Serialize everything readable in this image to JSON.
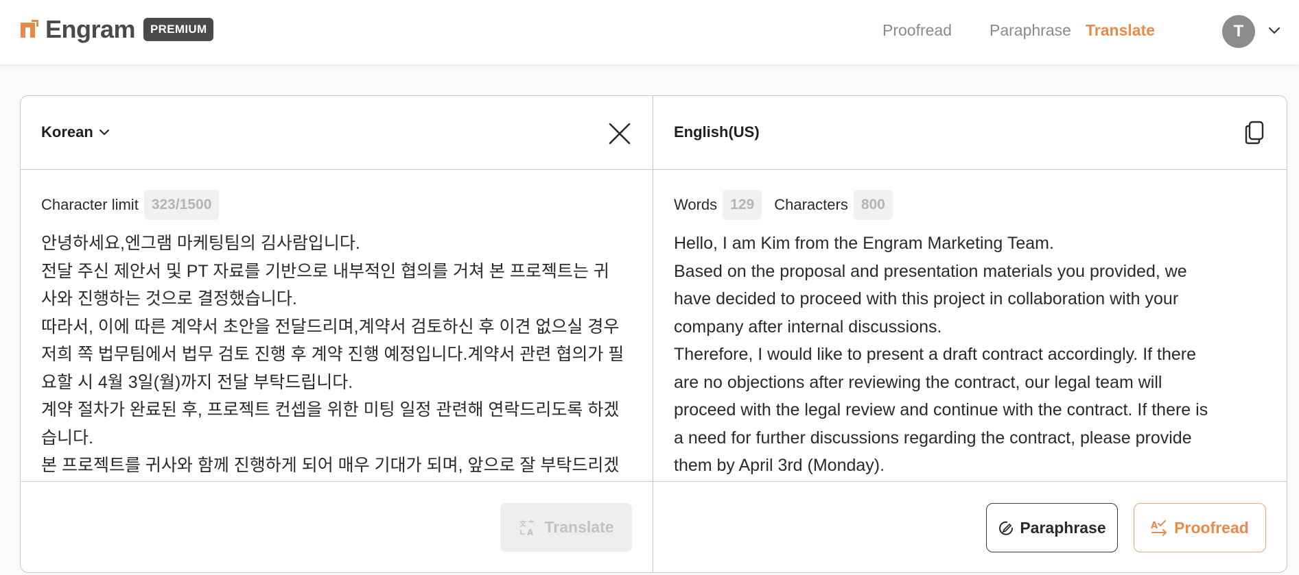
{
  "header": {
    "brand": "Engram",
    "badge": "PREMIUM",
    "nav": [
      {
        "label": "Proofread",
        "active": false
      },
      {
        "label": "Paraphrase",
        "active": false
      },
      {
        "label": "Translate",
        "active": true
      }
    ],
    "avatar_initial": "T",
    "accent_color": "#e98a4a"
  },
  "source": {
    "language": "Korean",
    "limit_label": "Character limit",
    "limit_value": "323/1500",
    "text": [
      "안녕하세요,엔그램 마케팅팀의 김사람입니다.",
      "전달 주신 제안서 및 PT 자료를 기반으로 내부적인 협의를 거쳐 본 프로젝트는 귀",
      "사와 진행하는 것으로 결정했습니다.",
      "따라서, 이에 따른 계약서 초안을 전달드리며,계약서 검토하신 후 이견 없으실 경우",
      "저희 쪽 법무팀에서 법무 검토 진행 후 계약 진행 예정입니다.계약서 관련 협의가 필",
      "요할 시 4월 3일(월)까지 전달 부탁드립니다.",
      "계약 절차가 완료된 후, 프로젝트 컨셉을 위한 미팅 일정 관련해 연락드리도록 하겠",
      "습니다.",
      "본 프로젝트를 귀사와 함께 진행하게 되어 매우 기대가 되며, 앞으로 잘 부탁드리겠"
    ],
    "translate_button": "Translate"
  },
  "target": {
    "language": "English(US)",
    "words_label": "Words",
    "words_value": "129",
    "chars_label": "Characters",
    "chars_value": "800",
    "text": [
      "Hello, I am Kim from the Engram Marketing Team.",
      "Based on the proposal and presentation materials you provided, we",
      "have decided to proceed with this project in collaboration with your",
      "company after internal discussions.",
      "Therefore, I would like to present a draft contract accordingly. If there",
      "are no objections after reviewing the contract, our legal team will",
      "proceed with the legal review and continue with the contract. If there is",
      "a need for further discussions regarding the contract, please provide",
      "them by April 3rd (Monday)."
    ],
    "paraphrase_button": "Paraphrase",
    "proofread_button": "Proofread"
  }
}
